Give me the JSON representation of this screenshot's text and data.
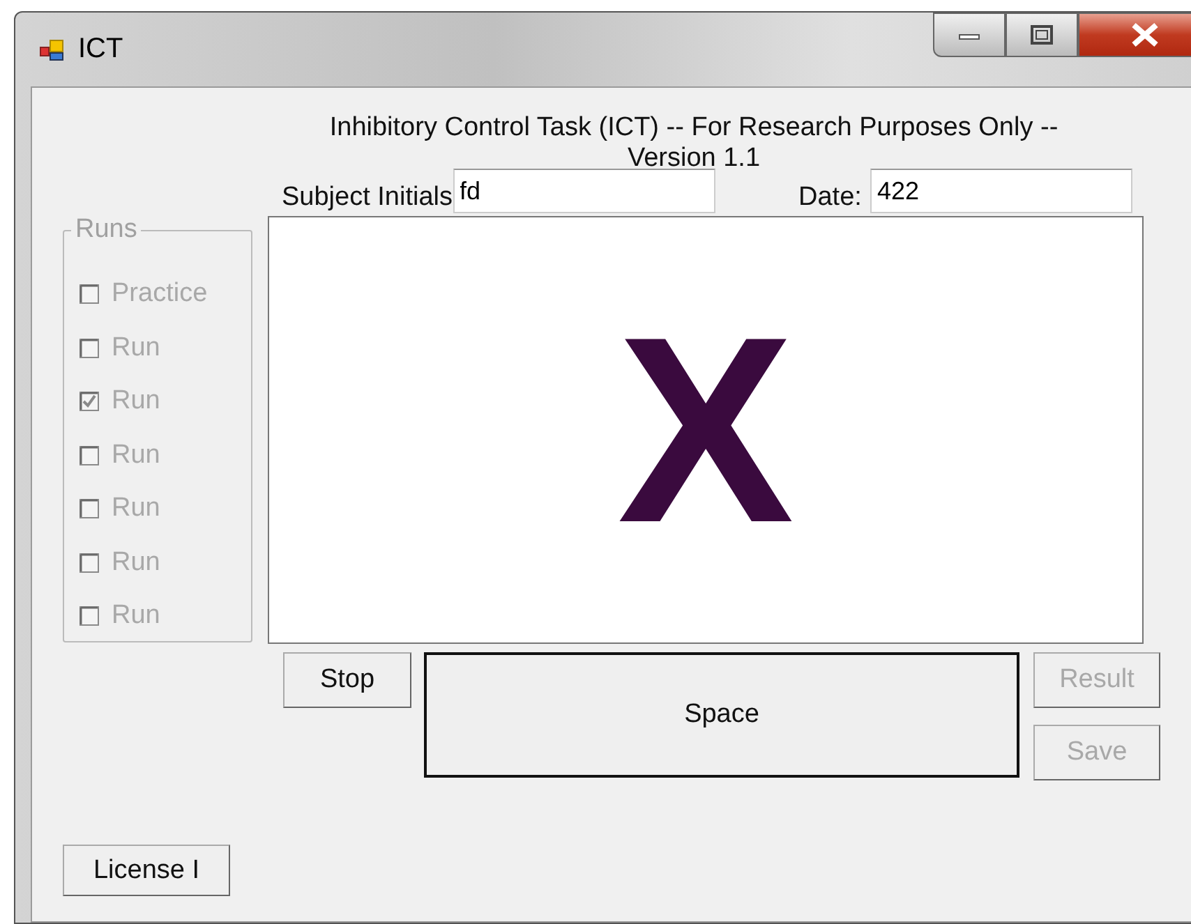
{
  "window": {
    "title": "ICT"
  },
  "heading": "Inhibitory Control Task (ICT) -- For Research Purposes Only -- Version 1.1",
  "subject_initials": {
    "label": "Subject Initials",
    "value": "fd"
  },
  "date": {
    "label": "Date:",
    "value": "422"
  },
  "runs": {
    "title": "Runs",
    "items": [
      {
        "label": "Practice",
        "checked": false,
        "disabled": true
      },
      {
        "label": "Run",
        "checked": false,
        "disabled": true
      },
      {
        "label": "Run",
        "checked": true,
        "disabled": true
      },
      {
        "label": "Run",
        "checked": false,
        "disabled": true
      },
      {
        "label": "Run",
        "checked": false,
        "disabled": true
      },
      {
        "label": "Run",
        "checked": false,
        "disabled": true
      },
      {
        "label": "Run",
        "checked": false,
        "disabled": true
      }
    ]
  },
  "stimulus": {
    "text": "X"
  },
  "stop_button": {
    "label": "Stop",
    "disabled": false
  },
  "space_button": {
    "label": "Space",
    "disabled": false
  },
  "result_button": {
    "label": "Result",
    "disabled": true
  },
  "save_button": {
    "label": "Save",
    "disabled": true
  },
  "license_button": {
    "label": "License I",
    "disabled": false
  }
}
